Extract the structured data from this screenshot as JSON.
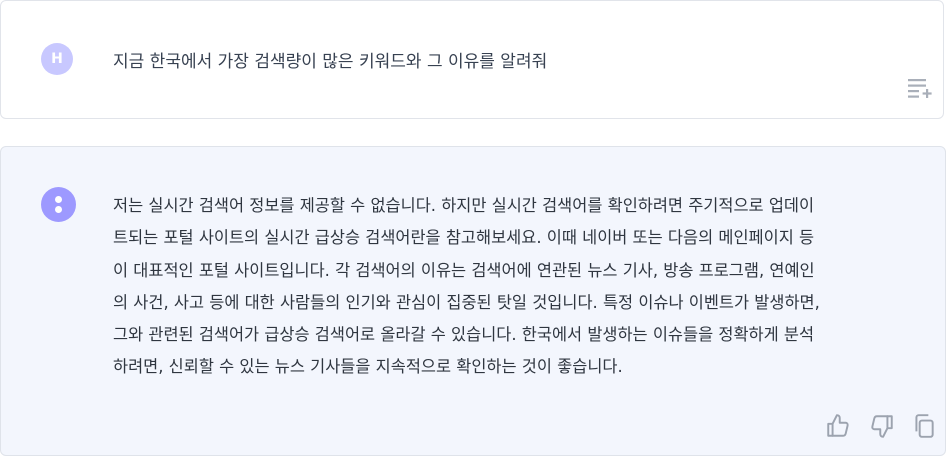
{
  "user_message": {
    "avatar_letter": "H",
    "text": "지금 한국에서 가장 검색량이 많은 키워드와 그 이유를 알려줘"
  },
  "assistant_message": {
    "lines": [
      "저는 실시간 검색어 정보를 제공할 수 없습니다. 하지만 실시간 검색어를 확인하려면 주기적으로 업데이",
      "트되는 포털 사이트의 실시간 급상승 검색어란을 참고해보세요. 이때 네이버 또는 다음의 메인페이지 등",
      "이 대표적인 포털 사이트입니다. 각 검색어의 이유는 검색어에 연관된 뉴스 기사, 방송 프로그램, 연예인",
      "의 사건, 사고 등에 대한 사람들의 인기와 관심이 집중된 탓일 것입니다. 특정 이슈나 이벤트가 발생하면,",
      "그와 관련된 검색어가 급상승 검색어로 올라갈 수 있습니다. 한국에서 발생하는 이슈들을 정확하게 분석",
      "하려면, 신뢰할 수 있는 뉴스 기사들을 지속적으로 확인하는 것이 좋습니다."
    ]
  },
  "icons": {
    "user_action": "playlist-add-icon",
    "feedback": [
      "thumb-up-icon",
      "thumb-down-icon",
      "copy-icon"
    ]
  },
  "colors": {
    "user_avatar": "#c8c8ff",
    "bot_avatar": "#9d99ff",
    "bot_background": "#f3f6fd",
    "icon_gray": "#9ca3af"
  }
}
